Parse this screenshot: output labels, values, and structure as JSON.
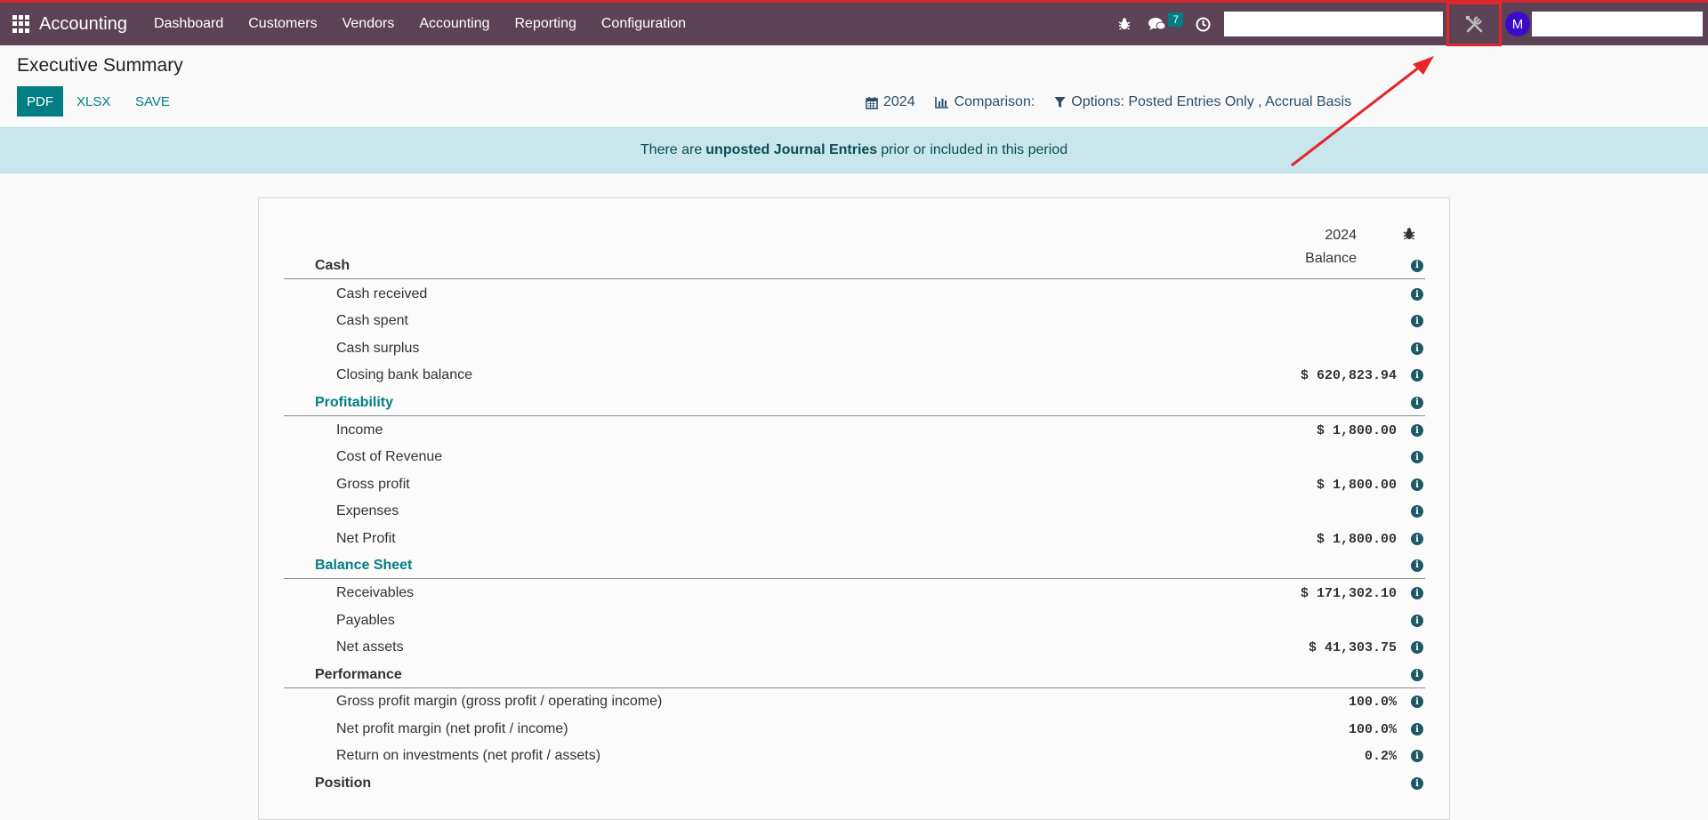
{
  "navbar": {
    "brand": "Accounting",
    "menu": [
      "Dashboard",
      "Customers",
      "Vendors",
      "Accounting",
      "Reporting",
      "Configuration"
    ],
    "messages_count": "7",
    "avatar_initial": "M",
    "icons": [
      "apps-grid-icon",
      "bug-icon",
      "chat-icon",
      "clock-icon",
      "tools-icon"
    ],
    "bg_color": "#5b4254"
  },
  "control": {
    "title": "Executive Summary",
    "buttons": {
      "pdf": "PDF",
      "xlsx": "XLSX",
      "save": "SAVE"
    },
    "filters": {
      "period": "2024",
      "comparison": "Comparison:",
      "options": "Options: Posted Entries Only , Accrual Basis"
    }
  },
  "alert": {
    "prefix": "There are",
    "strong": "unposted Journal Entries",
    "suffix": "prior or included in this period"
  },
  "report": {
    "column_year": "2024",
    "column_label": "Balance",
    "rows": [
      {
        "type": "section",
        "label": "Cash",
        "value": ""
      },
      {
        "type": "item",
        "label": "Cash received",
        "value": ""
      },
      {
        "type": "item",
        "label": "Cash spent",
        "value": ""
      },
      {
        "type": "item",
        "label": "Cash surplus",
        "value": ""
      },
      {
        "type": "item",
        "label": "Closing bank balance",
        "value": "$ 620,823.94"
      },
      {
        "type": "section",
        "label": "Profitability",
        "value": ""
      },
      {
        "type": "item",
        "label": "Income",
        "value": "$ 1,800.00"
      },
      {
        "type": "item",
        "label": "Cost of Revenue",
        "value": ""
      },
      {
        "type": "item",
        "label": "Gross profit",
        "value": "$ 1,800.00"
      },
      {
        "type": "item",
        "label": "Expenses",
        "value": ""
      },
      {
        "type": "item",
        "label": "Net Profit",
        "value": "$ 1,800.00"
      },
      {
        "type": "section",
        "label": "Balance Sheet",
        "value": ""
      },
      {
        "type": "item",
        "label": "Receivables",
        "value": "$ 171,302.10"
      },
      {
        "type": "item",
        "label": "Payables",
        "value": ""
      },
      {
        "type": "item",
        "label": "Net assets",
        "value": "$ 41,303.75"
      },
      {
        "type": "section",
        "label": "Performance",
        "value": ""
      },
      {
        "type": "item",
        "label": "Gross profit margin (gross profit / operating income)",
        "value": "100.0%"
      },
      {
        "type": "item",
        "label": "Net profit margin (net profit / income)",
        "value": "100.0%"
      },
      {
        "type": "item",
        "label": "Return on investments (net profit / assets)",
        "value": "0.2%"
      },
      {
        "type": "section",
        "label": "Position",
        "value": ""
      }
    ]
  },
  "colors": {
    "accent": "#017e84",
    "highlight": "#e3262a",
    "alert_bg": "#c8e6ec"
  }
}
